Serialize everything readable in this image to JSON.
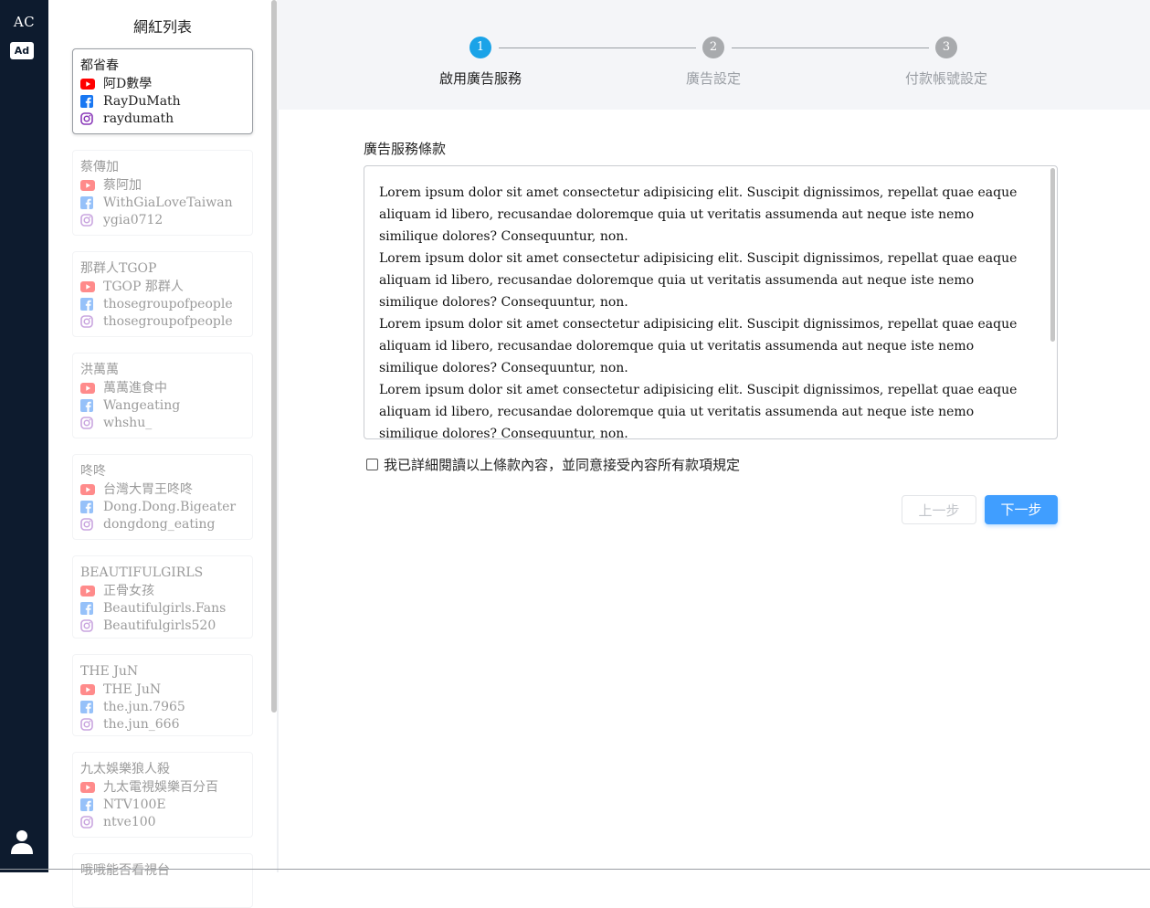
{
  "rail": {
    "logo": "AC",
    "ad_badge": "Ad"
  },
  "list": {
    "title": "網紅列表",
    "cards": [
      {
        "name": "都省春",
        "youtube": "阿D數學",
        "facebook": "RayDuMath",
        "instagram": "raydumath"
      },
      {
        "name": "蔡傳加",
        "youtube": "蔡阿加",
        "facebook": "WithGiaLoveTaiwan",
        "instagram": "ygia0712"
      },
      {
        "name": "那群人TGOP",
        "youtube": "TGOP 那群人",
        "facebook": "thosegroupofpeople",
        "instagram": "thosegroupofpeople"
      },
      {
        "name": "洪萬萬",
        "youtube": "萬萬進食中",
        "facebook": "Wangeating",
        "instagram": "whshu_"
      },
      {
        "name": "咚咚",
        "youtube": "台灣大胃王咚咚",
        "facebook": "Dong.Dong.Bigeater",
        "instagram": "dongdong_eating"
      },
      {
        "name": "BEAUTIFULGIRLS",
        "youtube": "正骨女孩",
        "facebook": "Beautifulgirls.Fans",
        "instagram": "Beautifulgirls520"
      },
      {
        "name": "THE JuN",
        "youtube": "THE JuN",
        "facebook": "the.jun.7965",
        "instagram": "the.jun_666"
      },
      {
        "name": "九太娛樂狼人殺",
        "youtube": "九太電視娛樂百分百",
        "facebook": "NTV100E",
        "instagram": "ntve100"
      },
      {
        "name": "哦哦能否看視台",
        "youtube": "",
        "facebook": "",
        "instagram": ""
      }
    ]
  },
  "steps": [
    {
      "number": "1",
      "label": "啟用廣告服務",
      "state": "active"
    },
    {
      "number": "2",
      "label": "廣告設定",
      "state": "pending"
    },
    {
      "number": "3",
      "label": "付款帳號設定",
      "state": "pending"
    }
  ],
  "terms": {
    "title": "廣告服務條款",
    "paragraphs": [
      "Lorem ipsum dolor sit amet consectetur adipisicing elit. Suscipit dignissimos, repellat quae eaque aliquam id libero, recusandae doloremque quia ut veritatis assumenda aut neque iste nemo similique dolores? Consequuntur, non.",
      "Lorem ipsum dolor sit amet consectetur adipisicing elit. Suscipit dignissimos, repellat quae eaque aliquam id libero, recusandae doloremque quia ut veritatis assumenda aut neque iste nemo similique dolores? Consequuntur, non.",
      "Lorem ipsum dolor sit amet consectetur adipisicing elit. Suscipit dignissimos, repellat quae eaque aliquam id libero, recusandae doloremque quia ut veritatis assumenda aut neque iste nemo similique dolores? Consequuntur, non.",
      "Lorem ipsum dolor sit amet consectetur adipisicing elit. Suscipit dignissimos, repellat quae eaque aliquam id libero, recusandae doloremque quia ut veritatis assumenda aut neque iste nemo similique dolores? Consequuntur, non."
    ],
    "agree_label": "我已詳細閱讀以上條款內容，並同意接受內容所有款項規定",
    "agree_checked": false
  },
  "buttons": {
    "prev": "上一步",
    "next": "下一步"
  },
  "colors": {
    "rail_bg": "#0d1b2e",
    "step_active": "#1aa3e8",
    "step_pending": "#a8aaad",
    "primary": "#409eff",
    "youtube": "#ff0000",
    "facebook": "#1877f2",
    "instagram": "#8a3ab9"
  },
  "icons": {
    "youtube": "youtube-icon",
    "facebook": "facebook-icon",
    "instagram": "instagram-icon",
    "user": "user-icon"
  }
}
